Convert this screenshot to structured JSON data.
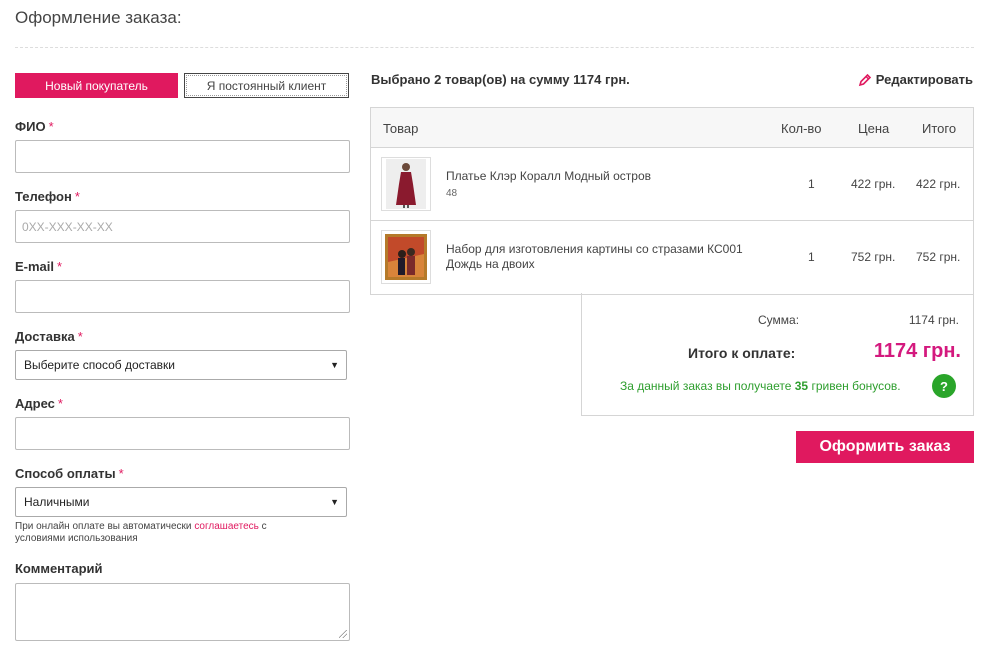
{
  "page": {
    "title": "Оформление заказа:"
  },
  "tabs": {
    "new_customer": "Новый покупатель",
    "returning_customer": "Я постоянный клиент"
  },
  "form": {
    "required_mark": "*",
    "fio_label": "ФИО",
    "fio_value": "",
    "phone_label": "Телефон",
    "phone_placeholder": "0XX-XXX-XX-XX",
    "email_label": "E-mail",
    "email_value": "",
    "delivery_label": "Доставка",
    "delivery_selected": "Выберите способ доставки",
    "address_label": "Адрес",
    "address_value": "",
    "payment_label": "Способ оплаты",
    "payment_selected": "Наличными",
    "note_text": "При онлайн оплате вы автоматически",
    "note_link": "соглашаетесь",
    "note_text2": "с условиями использования",
    "comment_label": "Комментарий"
  },
  "summary": {
    "heading": "Выбрано 2 товар(ов) на сумму 1174 грн.",
    "edit_label": "Редактировать"
  },
  "table": {
    "headers": {
      "product": "Товар",
      "qty": "Кол-во",
      "price": "Цена",
      "total": "Итого"
    },
    "rows": [
      {
        "name": "Платье Клэр Коралл Модный остров",
        "sub": "48",
        "qty": "1",
        "price": "422 грн.",
        "total": "422 грн.",
        "icon": "dress-thumbnail-icon"
      },
      {
        "name": "Набор для изготовления картины со стразами КС001 Дождь на двоих",
        "sub": "",
        "qty": "1",
        "price": "752 грн.",
        "total": "752 грн.",
        "icon": "painting-thumbnail-icon"
      }
    ]
  },
  "totals": {
    "sum_label": "Сумма:",
    "sum_value": "1174 грн.",
    "pay_label": "Итого к оплате:",
    "pay_value": "1174 грн.",
    "bonus_prefix": "За данный заказ вы получаете",
    "bonus_amount": "35",
    "bonus_suffix": "гривен бонусов.",
    "help_symbol": "?"
  },
  "actions": {
    "order_label": "Оформить заказ"
  },
  "colors": {
    "accent": "#e0195f",
    "price_accent": "#d4197e",
    "bonus_green": "#2e9e2e"
  }
}
